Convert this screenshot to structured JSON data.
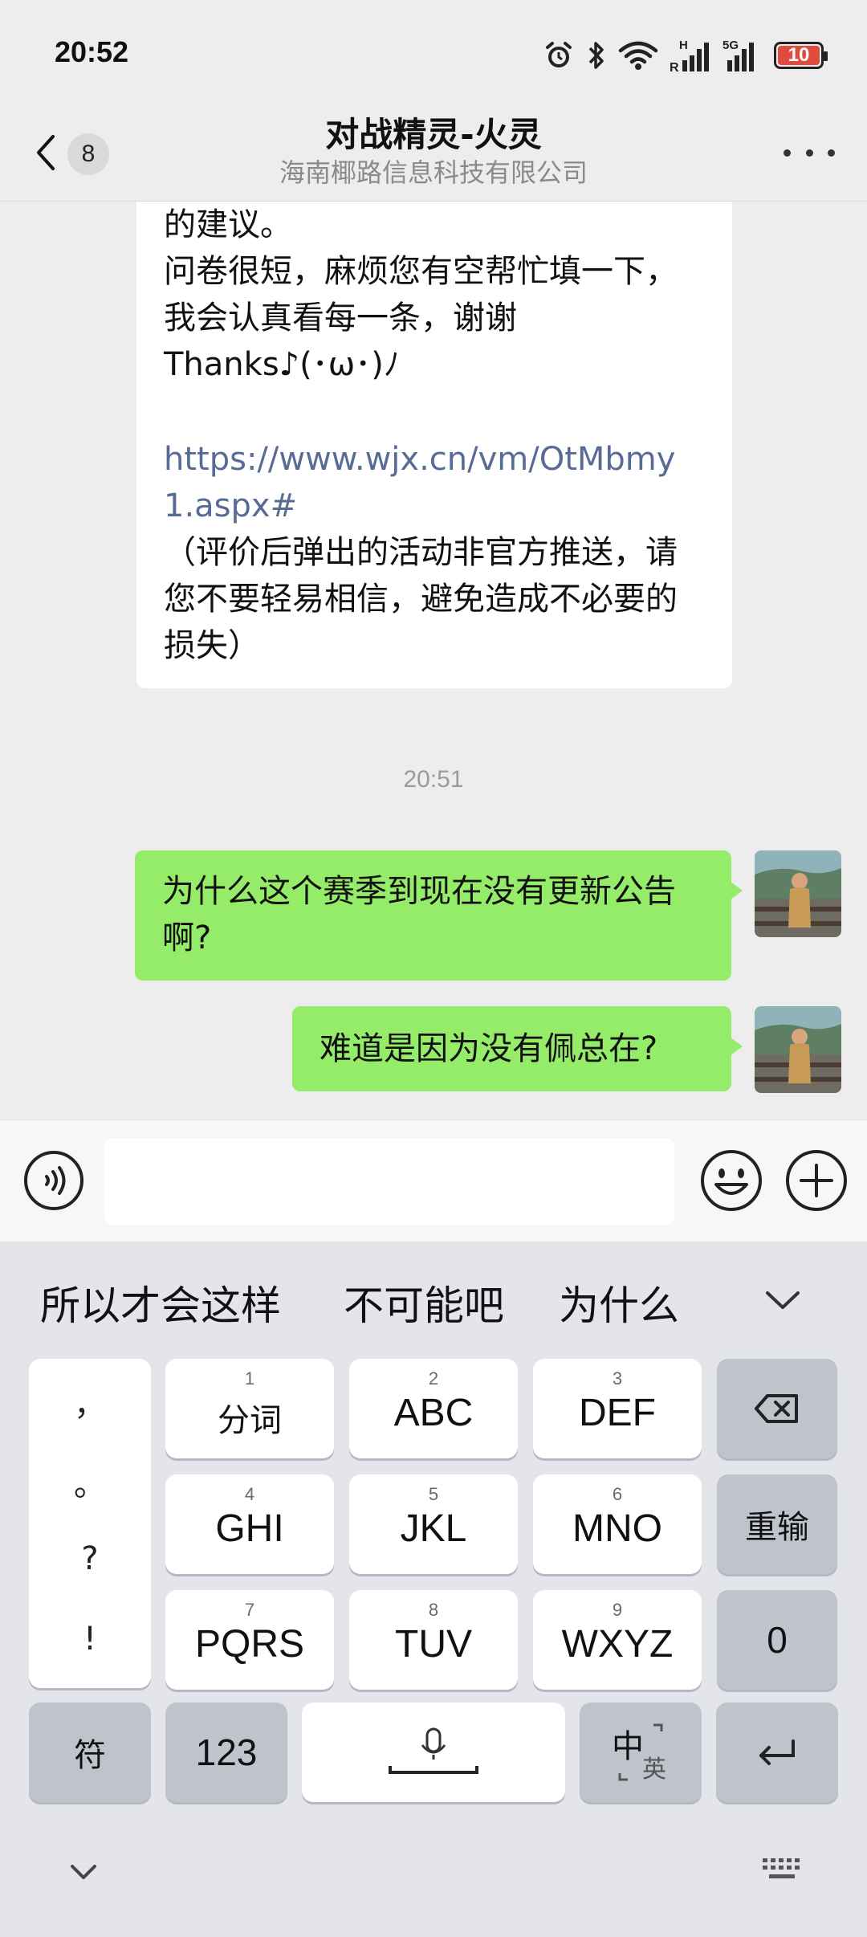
{
  "status_bar": {
    "time": "20:52",
    "icons": [
      "alarm-icon",
      "bluetooth-icon",
      "wifi-icon",
      "signal-r-icon",
      "signal-5g-icon"
    ],
    "battery_level": "10",
    "battery_color": "#E04A3F"
  },
  "nav": {
    "back_count": "8",
    "title": "对战精灵-火灵",
    "subtitle": "海南椰路信息科技有限公司"
  },
  "chat": {
    "incoming": {
      "line1": "的建议。",
      "line2": "问卷很短，麻烦您有空帮忙填一下，我会认真看每一条，谢谢",
      "line3": "Thanks♪(･ω･)ﾉ",
      "link": "https://www.wjx.cn/vm/OtMbmy1.aspx#",
      "note": "（评价后弹出的活动非官方推送，请您不要轻易相信，避免造成不必要的损失）"
    },
    "timestamp": "20:51",
    "outgoing": [
      "为什么这个赛季到现在没有更新公告啊?",
      "难道是因为没有佩总在?"
    ]
  },
  "input_bar": {
    "value": "",
    "placeholder": ""
  },
  "keyboard": {
    "suggestions": [
      "所以才会这样",
      "不可能吧",
      "为什么"
    ],
    "punctuation": [
      "，",
      "。",
      "?",
      "!"
    ],
    "keys": [
      {
        "num": "1",
        "label": "分词"
      },
      {
        "num": "2",
        "label": "ABC"
      },
      {
        "num": "3",
        "label": "DEF"
      },
      {
        "num": "4",
        "label": "GHI"
      },
      {
        "num": "5",
        "label": "JKL"
      },
      {
        "num": "6",
        "label": "MNO"
      },
      {
        "num": "7",
        "label": "PQRS"
      },
      {
        "num": "8",
        "label": "TUV"
      },
      {
        "num": "9",
        "label": "WXYZ"
      }
    ],
    "reinput_label": "重输",
    "zero_label": "0",
    "symbol_label": "符",
    "numbers_label": "123",
    "lang_main": "中",
    "lang_sub": "英",
    "accent_colors": {
      "sent_bubble": "#95EC69",
      "link": "#576B95"
    }
  }
}
